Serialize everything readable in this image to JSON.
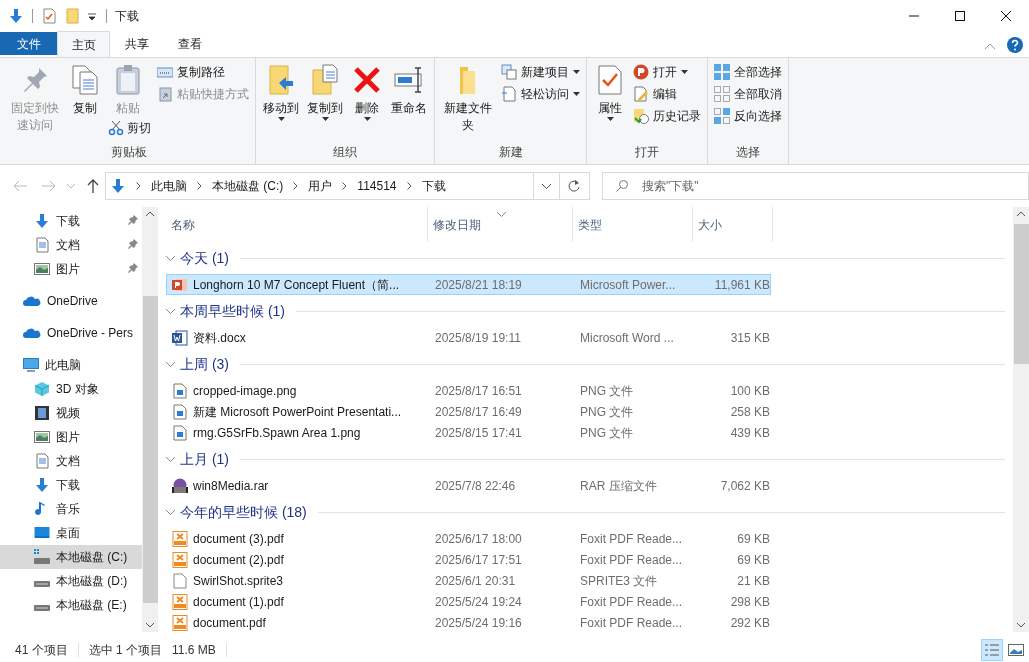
{
  "window": {
    "title": "下载"
  },
  "ribbon_tabs": [
    {
      "label": "文件",
      "kind": "file",
      "selected": false
    },
    {
      "label": "主页",
      "kind": "tab",
      "selected": true
    },
    {
      "label": "共享",
      "kind": "tab",
      "selected": false
    },
    {
      "label": "查看",
      "kind": "tab",
      "selected": false
    }
  ],
  "ribbon_groups": [
    {
      "label": "剪贴板",
      "columns": [
        {
          "kind": "large",
          "label": "固定到快速访问",
          "disabled": true,
          "dropdown": false
        },
        {
          "kind": "large",
          "label": "复制",
          "disabled": false,
          "dropdown": false
        },
        {
          "kind": "large",
          "label": "粘贴",
          "disabled": true,
          "dropdown": false,
          "sub": {
            "label": "剪切",
            "disabled": false
          }
        },
        {
          "kind": "stack",
          "items": [
            {
              "label": "复制路径",
              "disabled": false,
              "dropdown": false
            },
            {
              "label": "粘贴快捷方式",
              "disabled": true,
              "dropdown": false
            }
          ]
        }
      ]
    },
    {
      "label": "组织",
      "columns": [
        {
          "kind": "large",
          "label": "移动到",
          "disabled": false,
          "dropdown": true
        },
        {
          "kind": "large",
          "label": "复制到",
          "disabled": false,
          "dropdown": true
        },
        {
          "kind": "large",
          "label": "删除",
          "disabled": false,
          "dropdown": true
        },
        {
          "kind": "large",
          "label": "重命名",
          "disabled": false,
          "dropdown": false
        }
      ]
    },
    {
      "label": "新建",
      "columns": [
        {
          "kind": "large",
          "label": "新建文件夹",
          "disabled": false,
          "dropdown": false
        },
        {
          "kind": "stack",
          "items": [
            {
              "label": "新建项目",
              "disabled": false,
              "dropdown": true
            },
            {
              "label": "轻松访问",
              "disabled": false,
              "dropdown": true
            }
          ]
        }
      ]
    },
    {
      "label": "打开",
      "columns": [
        {
          "kind": "large",
          "label": "属性",
          "disabled": false,
          "dropdown": true
        },
        {
          "kind": "stack",
          "items": [
            {
              "label": "打开",
              "disabled": false,
              "dropdown": true
            },
            {
              "label": "编辑",
              "disabled": false,
              "dropdown": false
            },
            {
              "label": "历史记录",
              "disabled": false,
              "dropdown": false
            }
          ]
        }
      ]
    },
    {
      "label": "选择",
      "columns": [
        {
          "kind": "stack",
          "items": [
            {
              "label": "全部选择",
              "disabled": false,
              "dropdown": false
            },
            {
              "label": "全部取消",
              "disabled": false,
              "dropdown": false
            },
            {
              "label": "反向选择",
              "disabled": false,
              "dropdown": false
            }
          ]
        }
      ]
    }
  ],
  "address_bar": {
    "path": [
      "此电脑",
      "本地磁盘 (C:)",
      "用户",
      "114514",
      "下载"
    ]
  },
  "search": {
    "placeholder": "搜索\"下载\""
  },
  "navigation": {
    "quick_access": [
      {
        "label": "下载",
        "kind": "download",
        "pinned": true,
        "selected": false
      },
      {
        "label": "文档",
        "kind": "document",
        "pinned": true,
        "selected": false
      },
      {
        "label": "图片",
        "kind": "picture",
        "pinned": true,
        "selected": false
      }
    ],
    "locations": [
      {
        "label": "OneDrive",
        "kind": "cloud",
        "selected": false
      },
      {
        "label": "OneDrive - Pers",
        "kind": "cloud",
        "selected": false
      },
      {
        "label": "此电脑",
        "kind": "pc",
        "selected": false,
        "children": [
          {
            "label": "3D 对象",
            "kind": "cube",
            "selected": false
          },
          {
            "label": "视频",
            "kind": "video",
            "selected": false
          },
          {
            "label": "图片",
            "kind": "picture",
            "selected": false
          },
          {
            "label": "文档",
            "kind": "document",
            "selected": false
          },
          {
            "label": "下载",
            "kind": "download",
            "selected": false
          },
          {
            "label": "音乐",
            "kind": "music",
            "selected": false
          },
          {
            "label": "桌面",
            "kind": "desktop",
            "selected": false
          },
          {
            "label": "本地磁盘 (C:)",
            "kind": "system-drive",
            "selected": true
          },
          {
            "label": "本地磁盘 (D:)",
            "kind": "drive",
            "selected": false
          },
          {
            "label": "本地磁盘 (E:)",
            "kind": "drive",
            "selected": false
          }
        ]
      }
    ]
  },
  "table": {
    "columns": [
      "名称",
      "修改日期",
      "类型",
      "大小"
    ],
    "groups": [
      {
        "label": "今天 (1)",
        "files": [
          {
            "name": "Longhorn 10 M7 Concept Fluent（简...",
            "date": "2025/8/21 18:19",
            "type": "Microsoft Power...",
            "size": "11,961 KB",
            "kind": "ppt",
            "selected": true
          }
        ]
      },
      {
        "label": "本周早些时候 (1)",
        "files": [
          {
            "name": "资料.docx",
            "date": "2025/8/19 19:11",
            "type": "Microsoft Word ...",
            "size": "315 KB",
            "kind": "word",
            "selected": false
          }
        ]
      },
      {
        "label": "上周 (3)",
        "files": [
          {
            "name": "cropped-image.png",
            "date": "2025/8/17 16:51",
            "type": "PNG 文件",
            "size": "100 KB",
            "kind": "image",
            "selected": false
          },
          {
            "name": "新建 Microsoft PowerPoint Presentati...",
            "date": "2025/8/17 16:49",
            "type": "PNG 文件",
            "size": "258 KB",
            "kind": "image",
            "selected": false
          },
          {
            "name": "rmg.G5SrFb.Spawn Area 1.png",
            "date": "2025/8/15 17:41",
            "type": "PNG 文件",
            "size": "439 KB",
            "kind": "image",
            "selected": false
          }
        ]
      },
      {
        "label": "上月 (1)",
        "files": [
          {
            "name": "win8Media.rar",
            "date": "2025/7/8 22:46",
            "type": "RAR 压缩文件",
            "size": "7,062 KB",
            "kind": "archive",
            "selected": false
          }
        ]
      },
      {
        "label": "今年的早些时候 (18)",
        "files": [
          {
            "name": "document (3).pdf",
            "date": "2025/6/17 18:00",
            "type": "Foxit PDF Reade...",
            "size": "69 KB",
            "kind": "pdf",
            "selected": false
          },
          {
            "name": "document (2).pdf",
            "date": "2025/6/17 17:51",
            "type": "Foxit PDF Reade...",
            "size": "69 KB",
            "kind": "pdf",
            "selected": false
          },
          {
            "name": "SwirlShot.sprite3",
            "date": "2025/6/1 20:31",
            "type": "SPRITE3 文件",
            "size": "21 KB",
            "kind": "file",
            "selected": false
          },
          {
            "name": "document (1).pdf",
            "date": "2025/5/24 19:24",
            "type": "Foxit PDF Reade...",
            "size": "298 KB",
            "kind": "pdf",
            "selected": false
          },
          {
            "name": "document.pdf",
            "date": "2025/5/24 19:16",
            "type": "Foxit PDF Reade...",
            "size": "292 KB",
            "kind": "pdf",
            "selected": false
          }
        ]
      }
    ]
  },
  "status_bar": {
    "item_count": "41 个项目",
    "selection": "选中 1 个项目",
    "selection_size": "11.6 MB"
  },
  "view_buttons": [
    {
      "kind": "details",
      "selected": true
    },
    {
      "kind": "thumbnails",
      "selected": false
    }
  ]
}
